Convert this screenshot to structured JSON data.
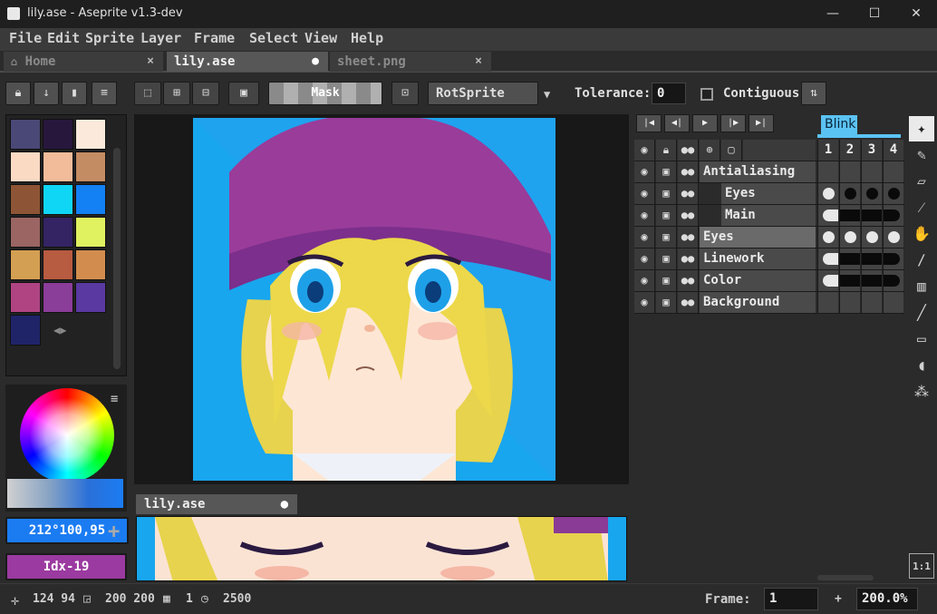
{
  "window": {
    "title": "lily.ase - Aseprite v1.3-dev",
    "minimize": "—",
    "maximize": "☐",
    "close": "✕"
  },
  "menu": [
    "File",
    "Edit",
    "Sprite",
    "Layer",
    "Frame",
    "Select",
    "View",
    "Help"
  ],
  "tabs": [
    {
      "label": "Home",
      "close": "×"
    },
    {
      "label": "lily.ase",
      "close": "●"
    },
    {
      "label": "sheet.png",
      "close": "×"
    }
  ],
  "context": {
    "mask_label": "Mask",
    "rotation_algorithm": "RotSprite",
    "tolerance_label": "Tolerance:",
    "tolerance_value": "0",
    "contiguous_label": "Contiguous"
  },
  "palette": [
    "#4a4876",
    "#28173d",
    "#fbeadb",
    "#fbdac3",
    "#f2bc9a",
    "#c48c63",
    "#8d5535",
    "#10d6f6",
    "#1380f4",
    "#9a6563",
    "#342463",
    "#e0f260",
    "#d39f52",
    "#b75b41",
    "#d28d4e",
    "#b04483",
    "#8b3d9a",
    "#5a39a0",
    "#1f2468"
  ],
  "colors": {
    "foreground_label": "212°100,95",
    "foreground_hex": "#1b7cf2",
    "background_label": "Idx-19",
    "background_hex": "#9b3aa0"
  },
  "preview": {
    "tab_label": "lily.ase"
  },
  "timeline": {
    "tag_name": "Blink",
    "frames": [
      "1",
      "2",
      "3",
      "4"
    ],
    "layers": [
      {
        "name": "Antialiasing",
        "indent": 0,
        "cels": [
          "none",
          "none",
          "none",
          "none"
        ]
      },
      {
        "name": "Eyes",
        "indent": 2,
        "cels": [
          "light",
          "dark",
          "dark",
          "dark"
        ]
      },
      {
        "name": "Main",
        "indent": 2,
        "cels": [
          "linked",
          "linked",
          "linked",
          "linked"
        ]
      },
      {
        "name": "Eyes",
        "indent": 0,
        "cels": [
          "light",
          "light",
          "light",
          "light"
        ]
      },
      {
        "name": "Linework",
        "indent": 0,
        "cels": [
          "linked",
          "linked",
          "linked",
          "linked"
        ]
      },
      {
        "name": "Color",
        "indent": 0,
        "cels": [
          "linked",
          "linked",
          "linked",
          "linked"
        ]
      },
      {
        "name": "Background",
        "indent": 0,
        "cels": [
          "none",
          "none",
          "none",
          "none"
        ]
      }
    ]
  },
  "toolbar": {
    "tools": [
      "magic-wand-icon",
      "pencil-icon",
      "eraser-icon",
      "eyedropper-icon",
      "hand-icon",
      "brush-icon",
      "gradient-icon",
      "line-icon",
      "rectangle-icon",
      "blur-icon",
      "spray-icon"
    ],
    "zoom_reset": "1:1"
  },
  "status": {
    "cursor": "124 94",
    "size": "200 200",
    "frame_count": "1",
    "duration": "2500",
    "frame_label": "Frame:",
    "frame_value": "1",
    "add": "+",
    "zoom": "200.0%"
  }
}
